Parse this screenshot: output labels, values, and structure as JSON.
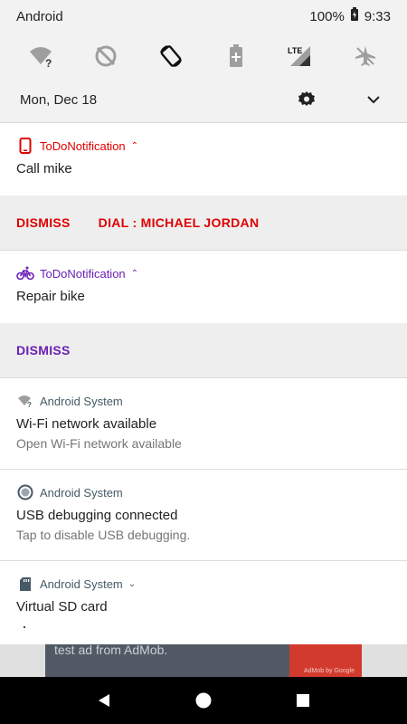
{
  "status_bar": {
    "carrier": "Android",
    "battery": "100%",
    "time": "9:33"
  },
  "quick_settings": {
    "icons": [
      "wifi-question-icon",
      "data-saver-off-icon",
      "auto-rotate-icon",
      "battery-saver-icon",
      "lte-signal-icon",
      "airplane-mode-icon"
    ],
    "lte_label": "LTE"
  },
  "shade": {
    "date": "Mon, Dec 18"
  },
  "notifications": [
    {
      "app": "ToDoNotification",
      "title": "Call mike",
      "accent": "#e00000",
      "actions": [
        "DISMISS",
        "DIAL : MICHAEL JORDAN"
      ]
    },
    {
      "app": "ToDoNotification",
      "title": "Repair bike",
      "accent": "#6a1fb5",
      "actions": [
        "DISMISS"
      ]
    },
    {
      "app": "Android System",
      "title": "Wi-Fi network available",
      "subtitle": "Open Wi-Fi network available",
      "accent": "#455a64"
    },
    {
      "app": "Android System",
      "title": "USB debugging connected",
      "subtitle": "Tap to disable USB debugging.",
      "accent": "#455a64"
    },
    {
      "app": "Android System",
      "title": "Virtual SD card",
      "accent": "#455a64"
    }
  ],
  "ad_banner": {
    "text": "test ad from AdMob.",
    "brand": "AdMob by Google"
  },
  "colors": {
    "todo_red": "#e00000",
    "todo_purple": "#6a1fb5",
    "system_slate": "#455a64"
  }
}
